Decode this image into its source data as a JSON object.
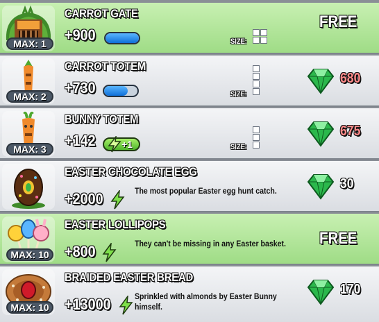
{
  "items": [
    {
      "name": "CARROT GATE",
      "income": "+900",
      "max": "MAX: 1",
      "size_label": "SIZE:",
      "price": "FREE",
      "bar_fill": 1.0
    },
    {
      "name": "CARROT TOTEM",
      "income": "+730",
      "max": "MAX: 2",
      "size_label": "SIZE:",
      "price": "680",
      "bar_fill": 0.7
    },
    {
      "name": "BUNNY TOTEM",
      "income": "+142",
      "max": "MAX: 3",
      "size_label": "SIZE:",
      "price": "675",
      "energy": "+1"
    },
    {
      "name": "EASTER CHOCOLATE EGG",
      "income": "+2000",
      "description": "The most popular Easter egg hunt catch.",
      "price": "30"
    },
    {
      "name": "EASTER LOLLIPOPS",
      "income": "+800",
      "max": "MAX: 10",
      "description": "They can't be missing in any Easter basket.",
      "price": "FREE"
    },
    {
      "name": "BRAIDED EASTER BREAD",
      "income": "+13000",
      "max": "MAX: 10",
      "description": "Sprinkled with almonds by Easter Bunny himself.",
      "price": "170"
    }
  ],
  "colors": {
    "row_green": "#b4e79c",
    "row_grey": "#e7e9ec",
    "price_unaffordable": "#ff8a8a",
    "price_affordable": "#ffffff",
    "gem": "#29b84a"
  },
  "icons": {
    "gem": "emerald-gem-icon",
    "energy": "lightning-bolt-icon",
    "size": "size-grid-icon"
  }
}
